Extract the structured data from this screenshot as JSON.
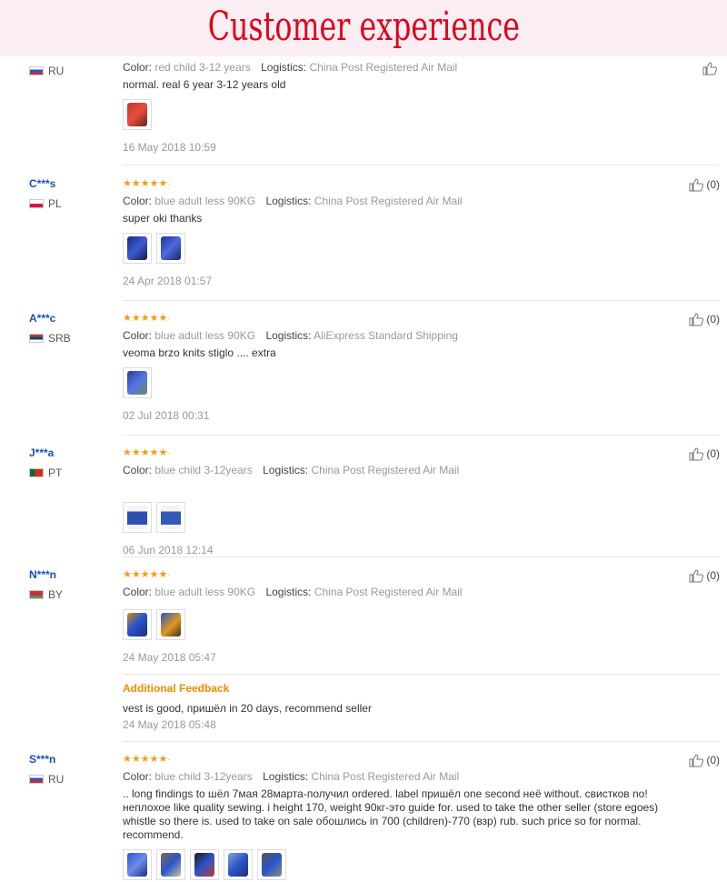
{
  "banner": {
    "title": "Customer experience"
  },
  "labels": {
    "color": "Color:",
    "logistics": "Logistics:",
    "helpful": "(0)"
  },
  "colors": {
    "star": "#f39c12",
    "username": "#1b4fb5",
    "feedback": "#f08c00",
    "banner_text": "#e0001b"
  },
  "reviews": [
    {
      "user": "",
      "country": "RU",
      "flag": "flag-ru",
      "color": "red child 3-12 years",
      "logistics": "China Post Registered Air Mail",
      "text": "normal. real 6 year 3-12 years old",
      "photos": [
        "red-vest-photo"
      ],
      "date": "16 May 2018 10:59"
    },
    {
      "user": "C***s",
      "country": "PL",
      "flag": "flag-pl",
      "rating": 5,
      "color": "blue adult less 90KG",
      "logistics": "China Post Registered Air Mail",
      "text": "super oki thanks",
      "photos": [
        "blue-vest-photo",
        "blue-vest-photo"
      ],
      "date": "24 Apr 2018 01:57",
      "helpful": "(0)"
    },
    {
      "user": "A***c",
      "country": "SRB",
      "flag": "flag-srb",
      "rating": 5,
      "color": "blue adult less 90KG",
      "logistics": "AliExpress Standard Shipping",
      "text": "veoma brzo knits stiglo .... extra",
      "photos": [
        "blue-vest-photo"
      ],
      "date": "02 Jul 2018 00:31",
      "helpful": "(0)"
    },
    {
      "user": "J***a",
      "country": "PT",
      "flag": "flag-pt",
      "rating": 5,
      "color": "blue child 3-12years",
      "logistics": "China Post Registered Air Mail",
      "text": "",
      "photos": [
        "child-vest-photo",
        "child-vest-photo"
      ],
      "date": "06 Jun 2018 12:14",
      "helpful": "(0)"
    },
    {
      "user": "N***n",
      "country": "BY",
      "flag": "flag-by",
      "rating": 5,
      "color": "blue adult less 90KG",
      "logistics": "China Post Registered Air Mail",
      "text": "",
      "photos": [
        "orange-blue-vest-photo",
        "orange-blue-vest-photo"
      ],
      "date": "24 May 2018 05:47",
      "helpful": "(0)",
      "additional": {
        "title": "Additional Feedback",
        "text": "vest is good, пришёл in 20 days, recommend seller",
        "date": "24 May 2018 05:48"
      }
    },
    {
      "user": "S***n",
      "country": "RU",
      "flag": "flag-ru",
      "rating": 5,
      "color": "blue child 3-12years",
      "logistics": "China Post Registered Air Mail",
      "text": ".. long findings to шёл 7мая 28марта-получил ordered. label пришёл one second неё without. свистков no! неплохое like quality sewing. i height 170, weight 90кг-это guide for. used to take the other seller (store egoes) whistle so there is. used to take on sale обошлись in 700 (children)-770 (взр) rub. such price so for normal. recommend.",
      "photos": [
        "blue-vest-photo",
        "blue-vest-photo",
        "blue-vest-photo",
        "blue-vest-photo",
        "blue-vest-photo"
      ],
      "helpful": "(0)"
    }
  ]
}
